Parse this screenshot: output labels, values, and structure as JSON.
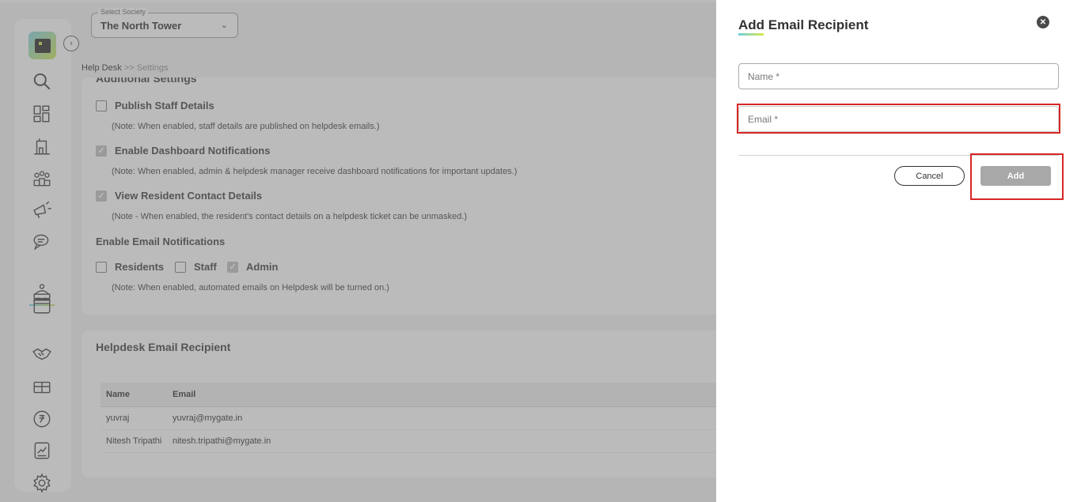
{
  "header": {
    "society_label": "Select Society",
    "society_value": "The North Tower",
    "breadcrumb_root": "Help Desk",
    "breadcrumb_sep": ">>",
    "breadcrumb_current": "Settings"
  },
  "sidebar": {
    "icons": [
      "search-icon",
      "dashboard-icon",
      "building-icon",
      "community-icon",
      "announcement-icon",
      "chat-icon",
      "helpdesk-icon",
      "calendar-icon",
      "handshake-icon",
      "amenity-icon",
      "rupee-icon",
      "reports-icon",
      "settings-icon"
    ],
    "active": "helpdesk-icon",
    "accent": "#6ed0e0"
  },
  "settings": {
    "section_title_clipped": "Additional Settings",
    "publish_staff": {
      "label": "Publish Staff Details",
      "checked": false,
      "note": "(Note: When enabled, staff details are published on helpdesk emails.)"
    },
    "dashboard_notif": {
      "label": "Enable Dashboard Notifications",
      "checked": true,
      "note": "(Note: When enabled, admin & helpdesk manager receive dashboard notifications for important updates.)"
    },
    "resident_contact": {
      "label": "View Resident Contact Details",
      "checked": true,
      "note": "(Note - When enabled, the resident's contact details on a helpdesk ticket can be unmasked.)"
    },
    "email_notif_title": "Enable Email Notifications",
    "email_notif_options": [
      {
        "label": "Residents",
        "checked": false
      },
      {
        "label": "Staff",
        "checked": false
      },
      {
        "label": "Admin",
        "checked": true
      }
    ],
    "email_notif_note": "(Note: When enabled, automated emails on Helpdesk will be turned on.)"
  },
  "recipients": {
    "title": "Helpdesk Email Recipient",
    "columns": [
      "Name",
      "Email"
    ],
    "rows": [
      [
        "yuvraj",
        "yuvraj@mygate.in"
      ],
      [
        "Nitesh Tripathi",
        "nitesh.tripathi@mygate.in"
      ]
    ]
  },
  "drawer": {
    "title": "Add Email Recipient",
    "name_placeholder": "Name *",
    "email_placeholder": "Email *",
    "cancel_label": "Cancel",
    "add_label": "Add",
    "highlight_color": "#d72626"
  }
}
